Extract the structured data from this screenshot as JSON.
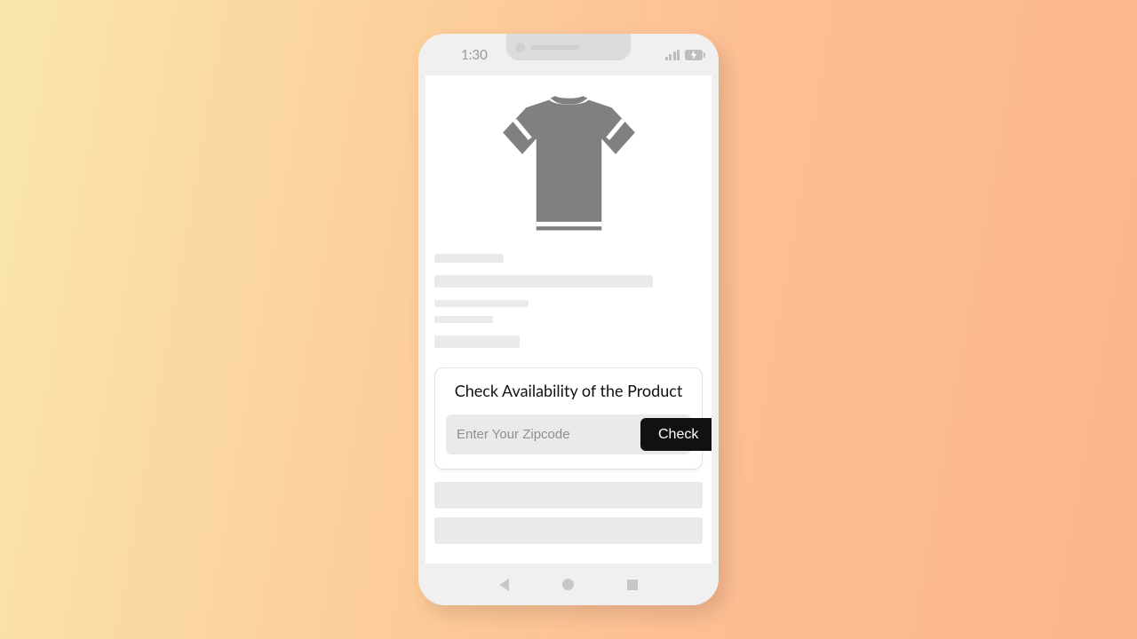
{
  "status": {
    "time": "1:30"
  },
  "availability": {
    "title": "Check Availability of the Product",
    "placeholder": "Enter Your Zipcode",
    "button": "Check"
  }
}
